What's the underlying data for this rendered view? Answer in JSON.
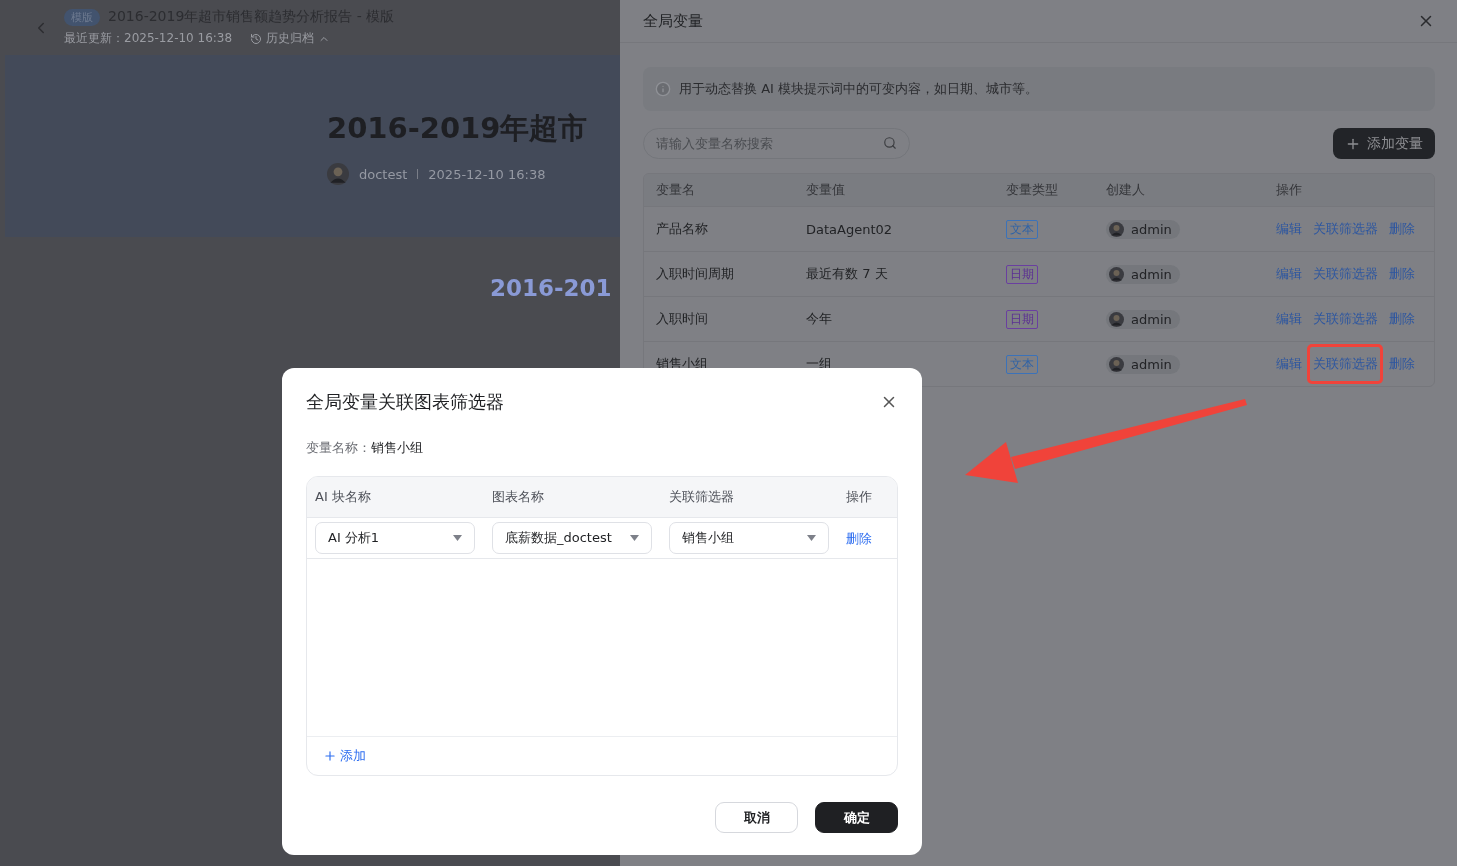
{
  "page": {
    "badge": "模版",
    "title": "2016-2019年超市销售额趋势分析报告 - 模版",
    "updated": "最近更新：2025-12-10 16:38",
    "history": "历史归档",
    "banner_title": "2016-2019年超市",
    "author": "doctest",
    "date": "2025-12-10 16:38",
    "section_heading": "2016-201"
  },
  "drawer": {
    "title": "全局变量",
    "info": "用于动态替换 AI 模块提示词中的可变内容，如日期、城市等。",
    "search": {
      "placeholder": "请输入变量名称搜索"
    },
    "add_button": "添加变量",
    "table": {
      "columns": [
        "变量名",
        "变量值",
        "变量类型",
        "创建人",
        "操作"
      ],
      "rows": [
        {
          "name": "产品名称",
          "value": "DataAgent02",
          "type": {
            "label": "文本",
            "kind": "text"
          },
          "creator": "admin",
          "actions": [
            {
              "label": "编辑",
              "highlighted": false
            },
            {
              "label": "关联筛选器",
              "highlighted": false
            },
            {
              "label": "删除",
              "highlighted": false
            }
          ]
        },
        {
          "name": "入职时间周期",
          "value": "最近有数 7 天",
          "type": {
            "label": "日期",
            "kind": "date"
          },
          "creator": "admin",
          "actions": [
            {
              "label": "编辑",
              "highlighted": false
            },
            {
              "label": "关联筛选器",
              "highlighted": false
            },
            {
              "label": "删除",
              "highlighted": false
            }
          ]
        },
        {
          "name": "入职时间",
          "value": "今年",
          "type": {
            "label": "日期",
            "kind": "date"
          },
          "creator": "admin",
          "actions": [
            {
              "label": "编辑",
              "highlighted": false
            },
            {
              "label": "关联筛选器",
              "highlighted": false
            },
            {
              "label": "删除",
              "highlighted": false
            }
          ]
        },
        {
          "name": "销售小组",
          "value": "一组",
          "type": {
            "label": "文本",
            "kind": "text"
          },
          "creator": "admin",
          "actions": [
            {
              "label": "编辑",
              "highlighted": false
            },
            {
              "label": "关联筛选器",
              "highlighted": true
            },
            {
              "label": "删除",
              "highlighted": false
            }
          ]
        }
      ]
    }
  },
  "modal": {
    "title": "全局变量关联图表筛选器",
    "field_label": "变量名称：",
    "field_value": "销售小组",
    "columns": [
      "AI 块名称",
      "图表名称",
      "关联筛选器",
      "操作"
    ],
    "rows": [
      {
        "ai_block": "AI 分析1",
        "chart": "底薪数据_doctest",
        "filter": "销售小组",
        "action": "删除"
      }
    ],
    "add_link": "添加",
    "buttons": [
      {
        "label": "取消",
        "kind": "secondary"
      },
      {
        "label": "确定",
        "kind": "primary"
      }
    ]
  }
}
